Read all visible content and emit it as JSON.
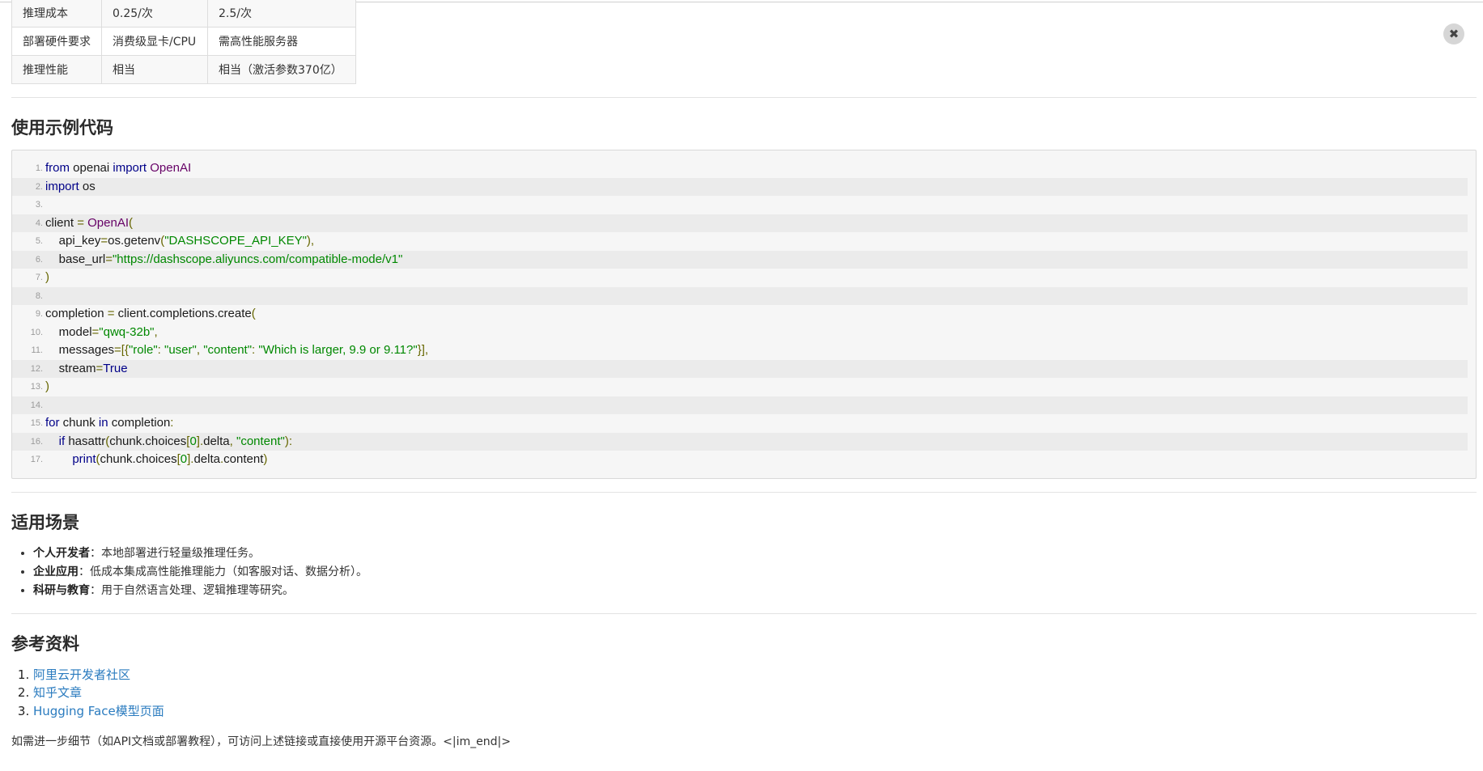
{
  "comparison_table": {
    "rows": [
      {
        "label": "推理成本",
        "qwq": "0.25/次",
        "other": "2.5/次"
      },
      {
        "label": "部署硬件要求",
        "qwq": "消费级显卡/CPU",
        "other": "需高性能服务器"
      },
      {
        "label": "推理性能",
        "qwq": "相当",
        "other": "相当（激活参数370亿）"
      }
    ]
  },
  "code_section": {
    "heading": "使用示例代码",
    "line_numbers": [
      "1.",
      "2.",
      "3.",
      "4.",
      "5.",
      "6.",
      "7.",
      "8.",
      "9.",
      "10.",
      "11.",
      "12.",
      "13.",
      "14.",
      "15.",
      "16.",
      "17."
    ],
    "tokens": {
      "l1": [
        "from",
        " openai ",
        "import",
        " OpenAI"
      ],
      "l2": [
        "import",
        " os"
      ],
      "l4": [
        "client ",
        "=",
        " ",
        "OpenAI",
        "("
      ],
      "l5": [
        "    api_key",
        "=",
        "os.getenv",
        "(",
        "\"DASHSCOPE_API_KEY\"",
        "),"
      ],
      "l6": [
        "    base_url",
        "=",
        "\"https://dashscope.aliyuncs.com/compatible-mode/v1\""
      ],
      "l7": [
        ")"
      ],
      "l9": [
        "completion ",
        "=",
        " client.completions.create",
        "("
      ],
      "l10": [
        "    model",
        "=",
        "\"qwq-32b\"",
        ","
      ],
      "l11": [
        "    messages",
        "=[{",
        "\"role\"",
        ": ",
        "\"user\"",
        ", ",
        "\"content\"",
        ": ",
        "\"Which is larger, 9.9 or 9.11?\"",
        "}],"
      ],
      "l12": [
        "    stream",
        "=",
        "True"
      ],
      "l13": [
        ")"
      ],
      "l15": [
        "for",
        " chunk ",
        "in",
        " completion",
        ":"
      ],
      "l16": [
        "    ",
        "if",
        " hasattr",
        "(",
        "chunk.choices",
        "[",
        "0",
        "]",
        ".",
        "delta",
        ", ",
        "\"content\"",
        "):"
      ],
      "l17": [
        "        ",
        "print",
        "(",
        "chunk.choices",
        "[",
        "0",
        "]",
        ".",
        "delta",
        ".",
        "content",
        ")"
      ]
    }
  },
  "scenarios": {
    "heading": "适用场景",
    "items": [
      {
        "title": "个人开发者",
        "desc": "：本地部署进行轻量级推理任务。"
      },
      {
        "title": "企业应用",
        "desc": "：低成本集成高性能推理能力（如客服对话、数据分析）。"
      },
      {
        "title": "科研与教育",
        "desc": "：用于自然语言处理、逻辑推理等研究。"
      }
    ]
  },
  "references": {
    "heading": "参考资料",
    "items": [
      {
        "label": "阿里云开发者社区"
      },
      {
        "label": "知乎文章"
      },
      {
        "label": "Hugging Face模型页面"
      }
    ]
  },
  "footer_note": "如需进一步细节（如API文档或部署教程），可访问上述链接或直接使用开源平台资源。<|im_end|>",
  "close_button": {
    "icon": "close-icon",
    "glyph": "✖"
  },
  "colors": {
    "link": "#2a7bbf",
    "code_keyword": "#000088",
    "code_type": "#660066",
    "code_string": "#008800",
    "code_punct": "#666600",
    "code_bg": "#f6f6f6"
  }
}
